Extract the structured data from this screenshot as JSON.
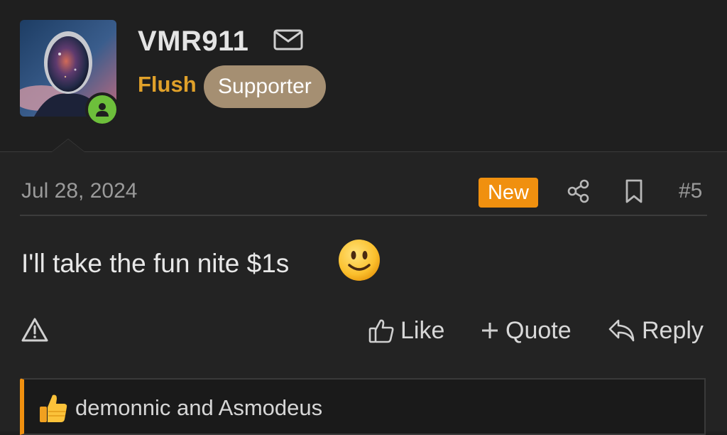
{
  "user": {
    "username": "VMR911",
    "title": "Flush",
    "badge": "Supporter",
    "status": "online",
    "avatar_icon": "space-helmet-avatar",
    "mail_icon": "envelope-icon"
  },
  "post": {
    "date": "Jul 28, 2024",
    "new_label": "New",
    "number": "#5",
    "text": "I'll take the fun nite $1s",
    "emoji": "slightly-smiling-face"
  },
  "actions": {
    "like": "Like",
    "quote": "Quote",
    "reply": "Reply"
  },
  "reactions": {
    "text": "demonnic and Asmodeus",
    "icon": "thumbs-up-emoji"
  },
  "colors": {
    "background": "#1f1f1f",
    "post_background": "#232323",
    "title_gold": "#e0a12a",
    "badge_tan": "#a58f72",
    "new_orange": "#f0900f",
    "online_green": "#6dbf3b"
  }
}
